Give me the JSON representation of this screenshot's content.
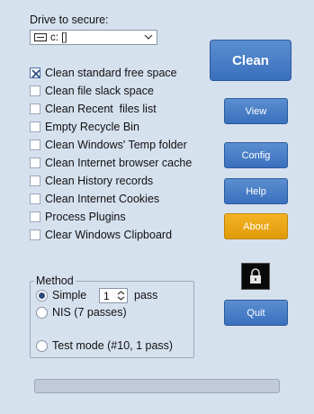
{
  "drive": {
    "label": "Drive to secure:",
    "selected_value": "c: []"
  },
  "options": [
    {
      "label": "Clean standard free space",
      "checked": true
    },
    {
      "label": "Clean file slack space",
      "checked": false
    },
    {
      "label": "Clean Recent  files list",
      "checked": false
    },
    {
      "label": "Empty Recycle Bin",
      "checked": false
    },
    {
      "label": "Clean Windows' Temp folder",
      "checked": false
    },
    {
      "label": "Clean Internet browser cache",
      "checked": false
    },
    {
      "label": "Clean History records",
      "checked": false
    },
    {
      "label": "Clean Internet Cookies",
      "checked": false
    },
    {
      "label": "Process Plugins",
      "checked": false
    },
    {
      "label": "Clear Windows Clipboard",
      "checked": false
    }
  ],
  "buttons": {
    "clean": "Clean",
    "view": "View",
    "config": "Config",
    "help": "Help",
    "about": "About",
    "quit": "Quit"
  },
  "method": {
    "legend": "Method",
    "simple_label": "Simple",
    "passes_value": "1",
    "pass_label": "pass",
    "nis_label": "NIS (7 passes)",
    "test_label": "Test mode (#10, 1 pass)",
    "selected": "simple"
  },
  "colors": {
    "background": "#d6e1ee",
    "button_blue": "#3a6fbe",
    "button_orange": "#e09a08"
  },
  "progress": 0
}
